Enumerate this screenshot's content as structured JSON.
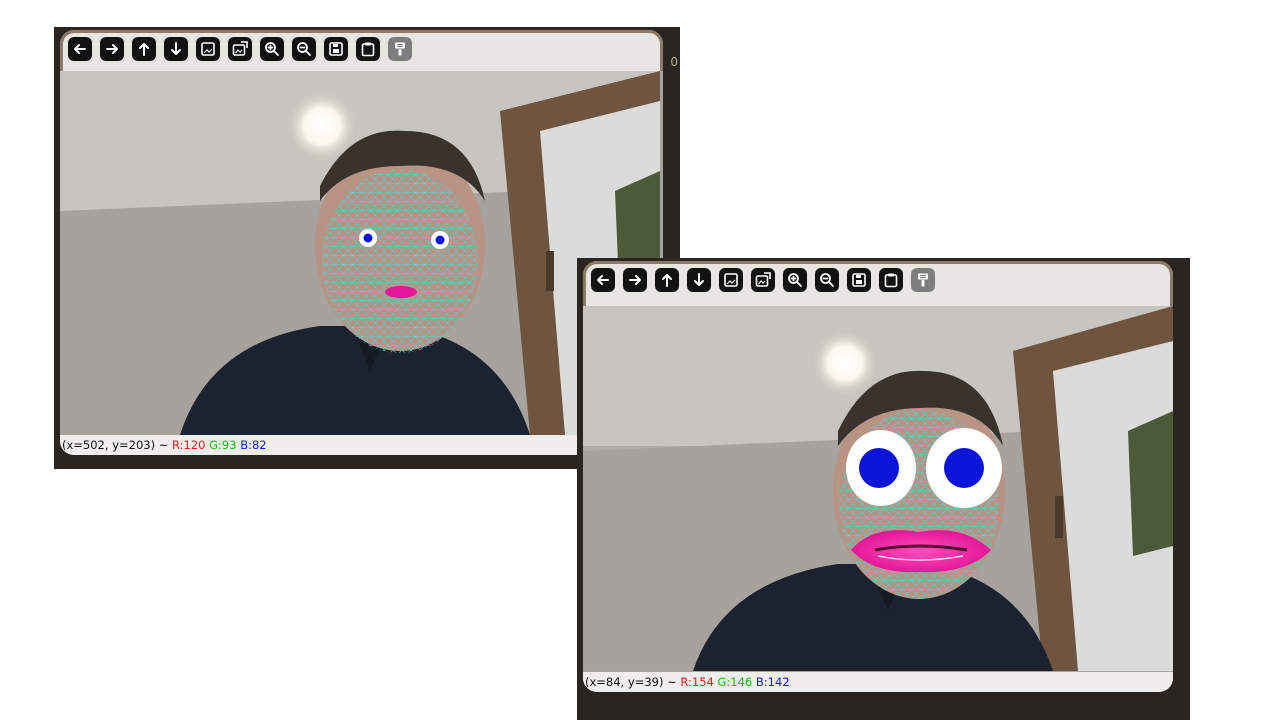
{
  "windows": [
    {
      "id": "left",
      "toolbar": [
        {
          "name": "back-icon"
        },
        {
          "name": "forward-icon"
        },
        {
          "name": "pan-up-icon"
        },
        {
          "name": "pan-down-icon"
        },
        {
          "name": "fit-image-icon"
        },
        {
          "name": "original-size-icon"
        },
        {
          "name": "zoom-in-icon"
        },
        {
          "name": "zoom-out-icon"
        },
        {
          "name": "save-icon"
        },
        {
          "name": "copy-clipboard-icon"
        },
        {
          "name": "properties-icon"
        }
      ],
      "status": {
        "coords": "(x=502, y=203) ~",
        "r": "R:120",
        "g": "G:93",
        "b": "B:82"
      },
      "edge_digit": "0"
    },
    {
      "id": "right",
      "toolbar": [
        {
          "name": "back-icon"
        },
        {
          "name": "forward-icon"
        },
        {
          "name": "pan-up-icon"
        },
        {
          "name": "pan-down-icon"
        },
        {
          "name": "fit-image-icon"
        },
        {
          "name": "original-size-icon"
        },
        {
          "name": "zoom-in-icon"
        },
        {
          "name": "zoom-out-icon"
        },
        {
          "name": "save-icon"
        },
        {
          "name": "copy-clipboard-icon"
        },
        {
          "name": "properties-icon"
        }
      ],
      "status": {
        "coords": "(x=84, y=39) ~",
        "r": "R:154",
        "g": "G:146",
        "b": "B:142"
      }
    }
  ],
  "colors": {
    "mesh": "#46d9d9",
    "iris": "#0b14d9",
    "lips": "#e4179a",
    "red": "#e02020",
    "green": "#10c010",
    "blue": "#1020e0"
  }
}
